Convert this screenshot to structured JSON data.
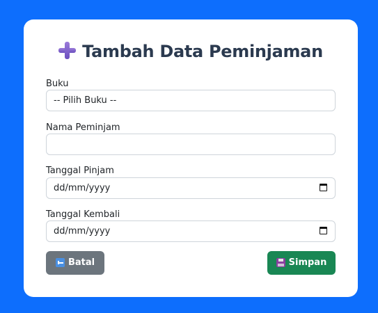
{
  "form": {
    "title": "Tambah Data Peminjaman",
    "title_icon": "plus-icon",
    "fields": {
      "buku": {
        "label": "Buku",
        "value": "-- Pilih Buku --"
      },
      "nama_peminjam": {
        "label": "Nama Peminjam",
        "value": "",
        "placeholder": ""
      },
      "tanggal_pinjam": {
        "label": "Tanggal Pinjam",
        "value": "dd/mm/yyyy"
      },
      "tanggal_kembali": {
        "label": "Tanggal Kembali",
        "value": "dd/mm/yyyy"
      }
    },
    "buttons": {
      "batal_label": "Batal",
      "batal_icon": "back-arrow-icon",
      "simpan_label": "Simpan",
      "simpan_icon": "floppy-disk-icon"
    }
  },
  "colors": {
    "background": "#0d6efd",
    "card": "#ffffff",
    "title": "#2b3a4f",
    "batal_button": "#6c757d",
    "simpan_button": "#198754"
  }
}
